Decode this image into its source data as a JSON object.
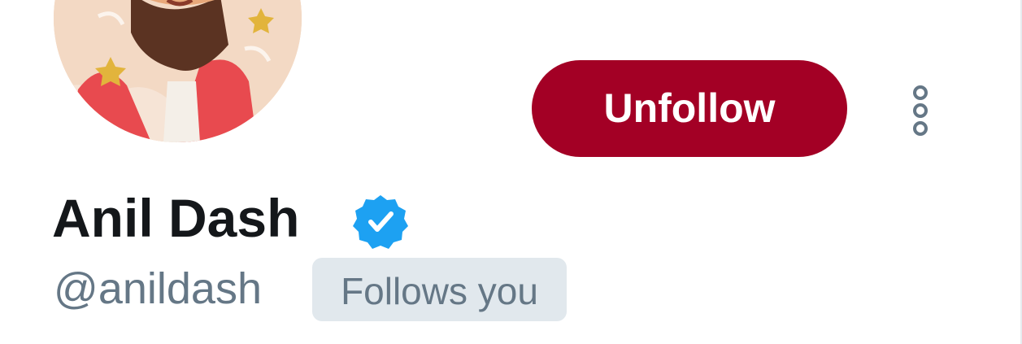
{
  "profile": {
    "display_name": "Anil Dash",
    "screen_name": "@anildash",
    "follows_you_label": "Follows you",
    "verified": true,
    "avatar_icon": "avatar-illustration"
  },
  "actions": {
    "unfollow_label": "Unfollow",
    "more_icon": "more-vertical-icon"
  },
  "colors": {
    "unfollow_background": "#a30025",
    "unfollow_text": "#ffffff",
    "verified_badge": "#1da1f2",
    "name_text": "#14171a",
    "secondary_text": "#657786",
    "badge_background": "#e1e8ed"
  }
}
